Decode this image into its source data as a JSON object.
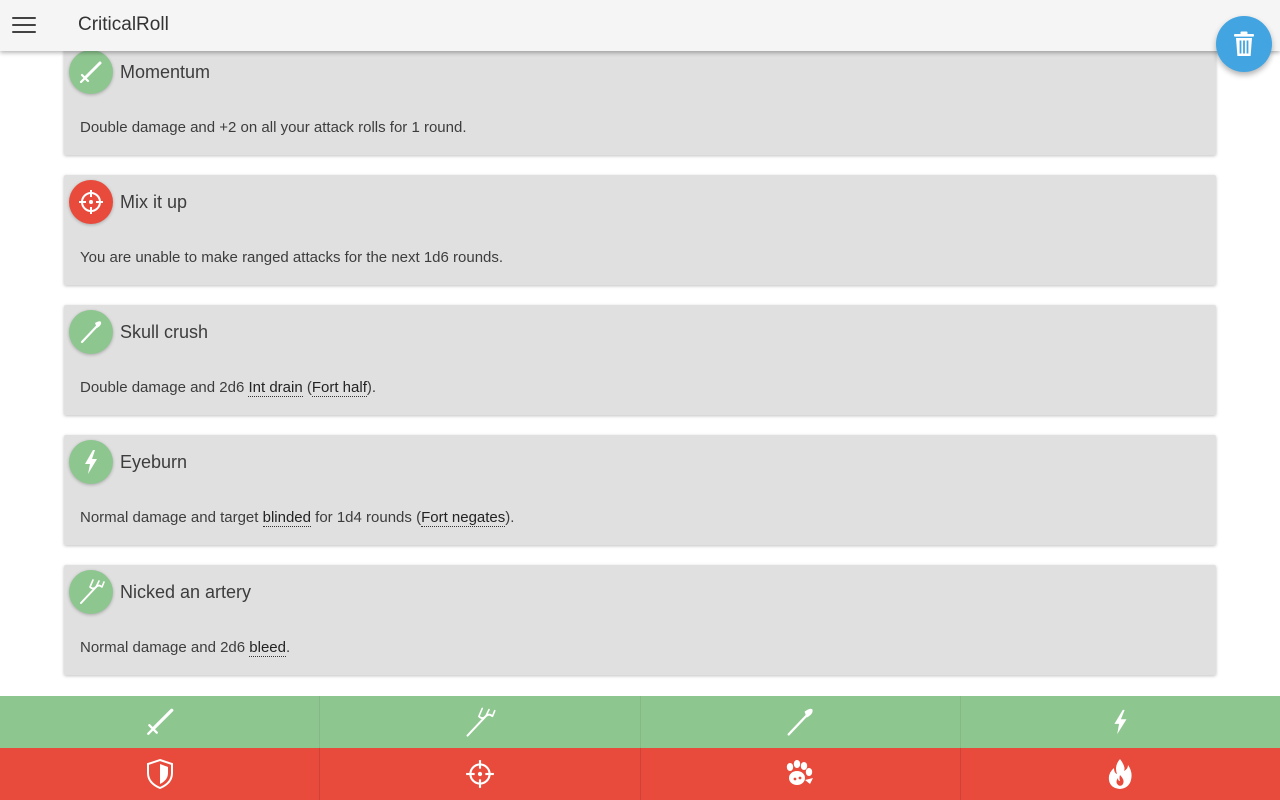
{
  "app": {
    "title": "CriticalRoll"
  },
  "colors": {
    "melee_green": "#8ec690",
    "effect_red": "#e84a3b",
    "fab_blue": "#42a5e2",
    "appbar": "#f5f5f5",
    "card": "#e0e0e0"
  },
  "fab": {
    "icon": "trash-icon"
  },
  "cards": [
    {
      "icon": "sword-icon",
      "badge": "green",
      "title": "Momentum",
      "parts": [
        "Double damage and +2 on all your attack rolls for 1 round."
      ]
    },
    {
      "icon": "crosshair-icon",
      "badge": "red",
      "title": "Mix it up",
      "parts": [
        "You are unable to make ranged attacks for the next 1d6 rounds."
      ]
    },
    {
      "icon": "club-icon",
      "badge": "green",
      "title": "Skull crush",
      "desc_prefix": "Double damage and 2d6 ",
      "link1": "Int drain",
      "desc_mid": " (",
      "link2": "Fort half",
      "desc_suffix": ")."
    },
    {
      "icon": "lightning-icon",
      "badge": "green",
      "title": "Eyeburn",
      "desc_prefix": "Normal damage and target ",
      "link1": "blinded",
      "desc_mid": " for 1d4 rounds (",
      "link2": "Fort negates",
      "desc_suffix": ")."
    },
    {
      "icon": "trident-icon",
      "badge": "green",
      "title": "Nicked an artery",
      "desc_prefix": "Normal damage and 2d6 ",
      "link1": "bleed",
      "desc_suffix": "."
    }
  ],
  "bottom_tabs_top": [
    {
      "icon": "sword-icon"
    },
    {
      "icon": "trident-icon"
    },
    {
      "icon": "club-icon"
    },
    {
      "icon": "lightning-icon"
    }
  ],
  "bottom_tabs_bottom": [
    {
      "icon": "shield-icon"
    },
    {
      "icon": "crosshair-icon"
    },
    {
      "icon": "paw-icon"
    },
    {
      "icon": "fire-icon"
    }
  ]
}
